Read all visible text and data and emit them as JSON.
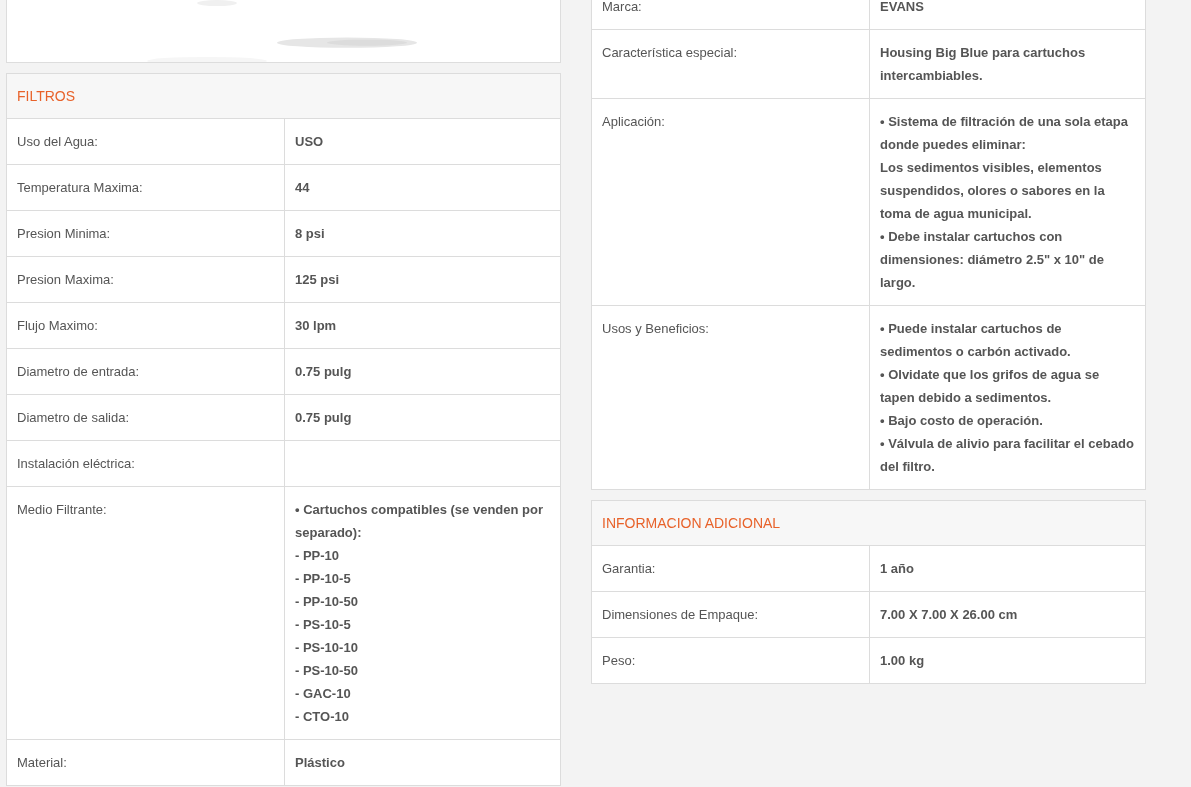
{
  "left_column": {
    "tables": [
      {
        "title": "FILTROS",
        "rows": [
          {
            "label": "Uso del Agua:",
            "value": [
              "USO"
            ]
          },
          {
            "label": "Temperatura Maxima:",
            "value": [
              "44"
            ]
          },
          {
            "label": "Presion Minima:",
            "value": [
              "8 psi"
            ]
          },
          {
            "label": "Presion Maxima:",
            "value": [
              "125 psi"
            ]
          },
          {
            "label": "Flujo Maximo:",
            "value": [
              "30 lpm"
            ]
          },
          {
            "label": "Diametro de entrada:",
            "value": [
              "0.75 pulg"
            ]
          },
          {
            "label": "Diametro de salida:",
            "value": [
              "0.75 pulg"
            ]
          },
          {
            "label": "Instalación eléctrica:"
          },
          {
            "label": "Medio Filtrante:",
            "value": [
              "• Cartuchos compatibles (se venden por separado):",
              "- PP-10",
              "- PP-10-5",
              "- PP-10-50",
              "- PS-10-5",
              "- PS-10-10",
              "- PS-10-50",
              "- GAC-10",
              "- CTO-10"
            ]
          },
          {
            "label": "Material:",
            "value": [
              "Plástico"
            ]
          }
        ]
      }
    ]
  },
  "right_column": {
    "tables": [
      {
        "rows": [
          {
            "label": "Marca:",
            "value": [
              "EVANS"
            ]
          },
          {
            "label": "Característica especial:",
            "value": [
              "Housing Big Blue para cartuchos intercambiables."
            ]
          },
          {
            "label": "Aplicación:",
            "value": [
              "• Sistema de filtración de una sola etapa donde puedes eliminar:",
              "Los sedimentos visibles, elementos suspendidos, olores o sabores en la toma de agua municipal.",
              "• Debe instalar cartuchos con dimensiones: diámetro 2.5\" x 10\" de largo."
            ]
          },
          {
            "label": "Usos y Beneficios:",
            "value": [
              "• Puede instalar cartuchos de sedimentos o carbón activado.",
              "• Olvidate que los grifos de agua se tapen debido a sedimentos.",
              "• Bajo costo de operación.",
              "• Válvula de alivio para facilitar el cebado del filtro."
            ]
          }
        ]
      },
      {
        "title": "INFORMACION ADICIONAL",
        "rows": [
          {
            "label": "Garantia:",
            "value": [
              "1 año"
            ]
          },
          {
            "label": "Dimensiones de Empaque:",
            "value": [
              "7.00 X 7.00 X 26.00 cm"
            ]
          },
          {
            "label": "Peso:",
            "value": [
              "1.00 kg"
            ]
          }
        ]
      }
    ]
  }
}
